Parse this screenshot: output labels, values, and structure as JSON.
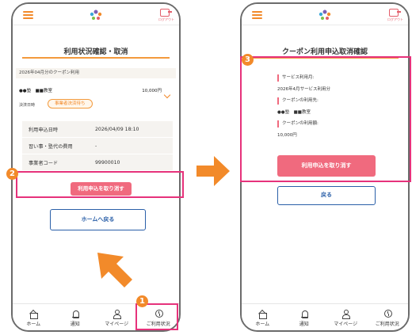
{
  "common": {
    "logout_label": "ログアウト",
    "tabs": [
      {
        "label": "ホーム",
        "icon": "home-icon"
      },
      {
        "label": "通知",
        "icon": "bell-icon"
      },
      {
        "label": "マイページ",
        "icon": "user-icon"
      },
      {
        "label": "ご利用状況",
        "icon": "status-icon"
      }
    ]
  },
  "left": {
    "title": "利用状況確認・取消",
    "coupon_month": "2026年04月分のクーポン利用",
    "shop": "●●塾　■■教室",
    "amount": "10,000円",
    "pay_label": "決済日時",
    "pay_status": "事業者決済待ち",
    "rows": [
      {
        "k": "利用申込日時",
        "v": "2026/04/09 18:10"
      },
      {
        "k": "習い事・塾代の費用",
        "v": "-"
      },
      {
        "k": "事業者コード",
        "v": "99900010"
      }
    ],
    "cancel_button": "利用申込を取り消す",
    "home_button": "ホームへ戻る"
  },
  "right": {
    "title": "クーポン利用申込取消確認",
    "items": [
      {
        "head": "サービス利用月:",
        "value": "2026年4月サービス利用分"
      },
      {
        "head": "クーポンの利用先:",
        "value": "●●塾　■■教室"
      },
      {
        "head": "クーポンの利用額:",
        "value": "10,000円"
      }
    ],
    "cancel_button": "利用申込を取り消す",
    "back_button": "戻る"
  },
  "steps": [
    "1",
    "2",
    "3"
  ],
  "colors": {
    "accent_orange": "#f28a2a",
    "cancel_pink": "#f06a7e",
    "highlight_magenta": "#e6327b",
    "outline_blue": "#2a5fa8"
  }
}
